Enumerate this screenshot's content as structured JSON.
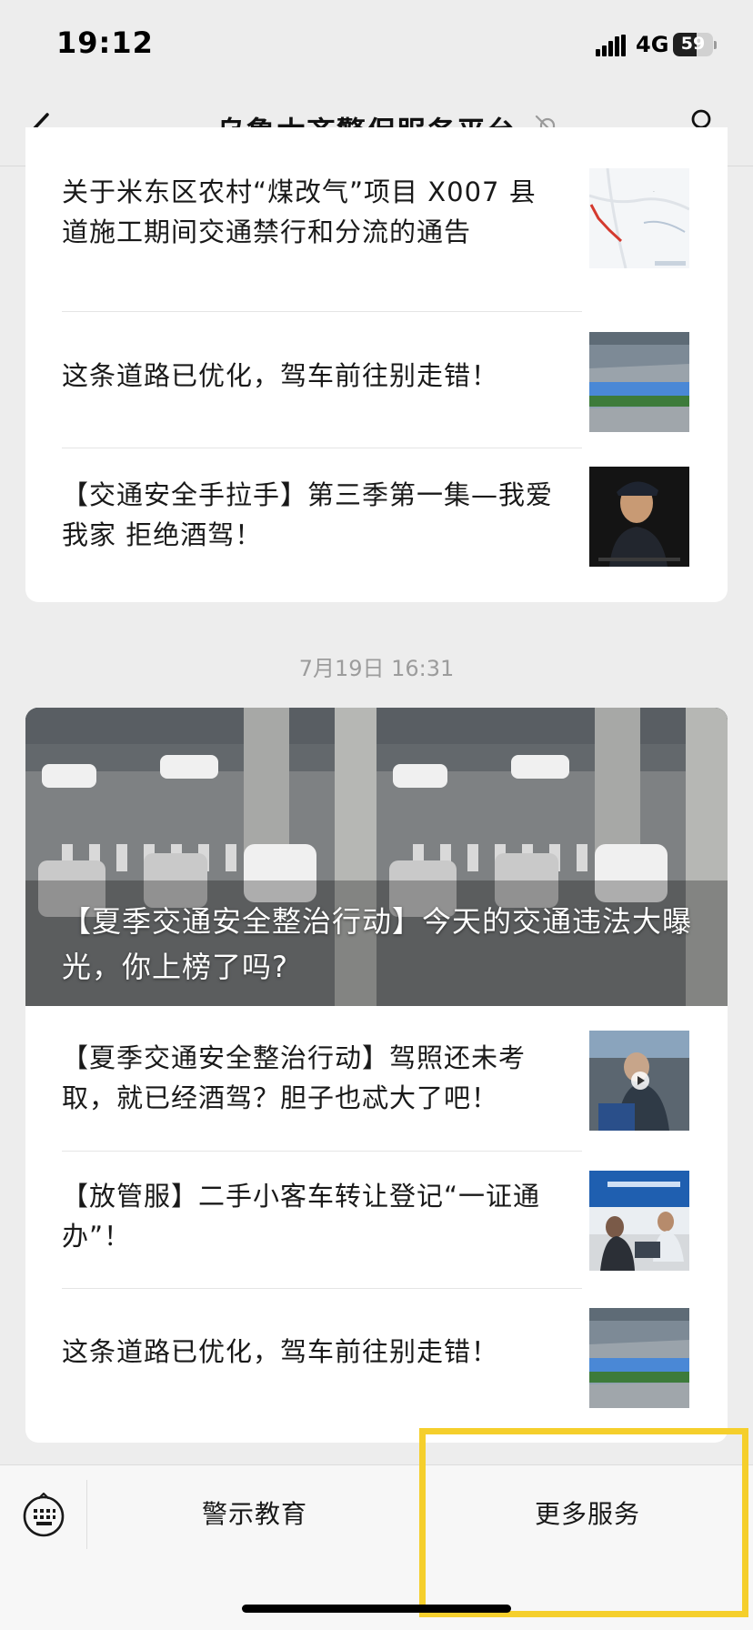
{
  "status_bar": {
    "time": "19:12",
    "network": "4G",
    "battery": "59"
  },
  "nav": {
    "title": "乌鲁木齐警保服务平台"
  },
  "feed": {
    "group_one": [
      {
        "title": "关于米东区农村“煤改气”项目 X007 县道施工期间交通禁行和分流的通告",
        "thumb": "map-thumbnail"
      },
      {
        "title": "这条道路已优化，驾车前往别走错！",
        "thumb": "road-photo-thumbnail"
      },
      {
        "title": "【交通安全手拉手】第三季第一集—我爱我家 拒绝酒驾！",
        "thumb": "child-police-video-thumbnail"
      }
    ],
    "timestamp": "7月19日 16:31",
    "group_two": {
      "hero_title": "【夏季交通安全整治行动】今天的交通违法大曝光，你上榜了吗?",
      "items": [
        {
          "title": "【夏季交通安全整治行动】驾照还未考取，就已经酒驾？胆子也忒大了吧！",
          "thumb": "traffic-police-video-thumbnail"
        },
        {
          "title": "【放管服】二手小客车转让登记“一证通办”！",
          "thumb": "service-hall-thumbnail"
        },
        {
          "title": "这条道路已优化，驾车前往别走错！",
          "thumb": "road-photo-thumbnail"
        }
      ]
    }
  },
  "bottom_menu": {
    "items": [
      "警示教育",
      "更多服务"
    ]
  },
  "colors": {
    "background": "#ededed",
    "highlight": "#f5cf2c",
    "timestamp": "#9c9c9c"
  }
}
